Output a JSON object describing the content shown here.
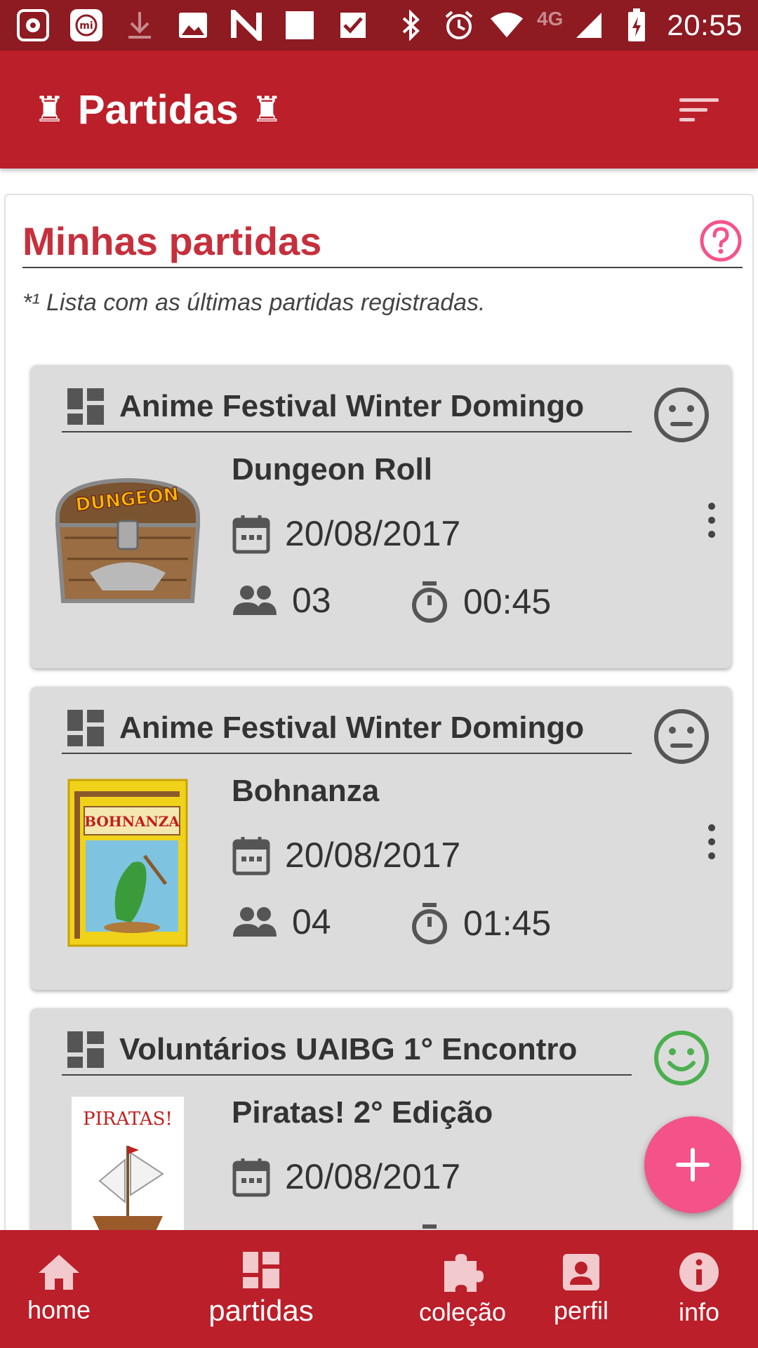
{
  "status_bar": {
    "time": "20:55",
    "network": "4G"
  },
  "app_bar": {
    "title": "Partidas",
    "rook_glyph": "♜"
  },
  "section": {
    "title": "Minhas partidas",
    "subtitle": "*¹ Lista com as últimas partidas registradas."
  },
  "matches": [
    {
      "event": "Anime Festival Winter Domingo",
      "game": "Dungeon Roll",
      "date": "20/08/2017",
      "players": "03",
      "duration": "00:45",
      "mood": "neutral"
    },
    {
      "event": "Anime Festival Winter Domingo",
      "game": "Bohnanza",
      "date": "20/08/2017",
      "players": "04",
      "duration": "01:45",
      "mood": "neutral"
    },
    {
      "event": "Voluntários UAIBG 1° Encontro",
      "game": "Piratas! 2° Edição",
      "date": "20/08/2017",
      "mood": "happy"
    }
  ],
  "thumb_text": {
    "dungeon": "DUNGEON",
    "bohnanza": "BOHNANZA",
    "piratas": "PIRATAS!"
  },
  "bottom_nav": {
    "home": "home",
    "partidas": "partidas",
    "colecao": "coleção",
    "perfil": "perfil",
    "info": "info"
  },
  "colors": {
    "primary": "#bb1f2a",
    "status_bar": "#8e1a22",
    "accent": "#f4538a",
    "card_bg": "#dcdcdc",
    "mood_neutral": "#555555",
    "mood_happy": "#4caf50"
  }
}
